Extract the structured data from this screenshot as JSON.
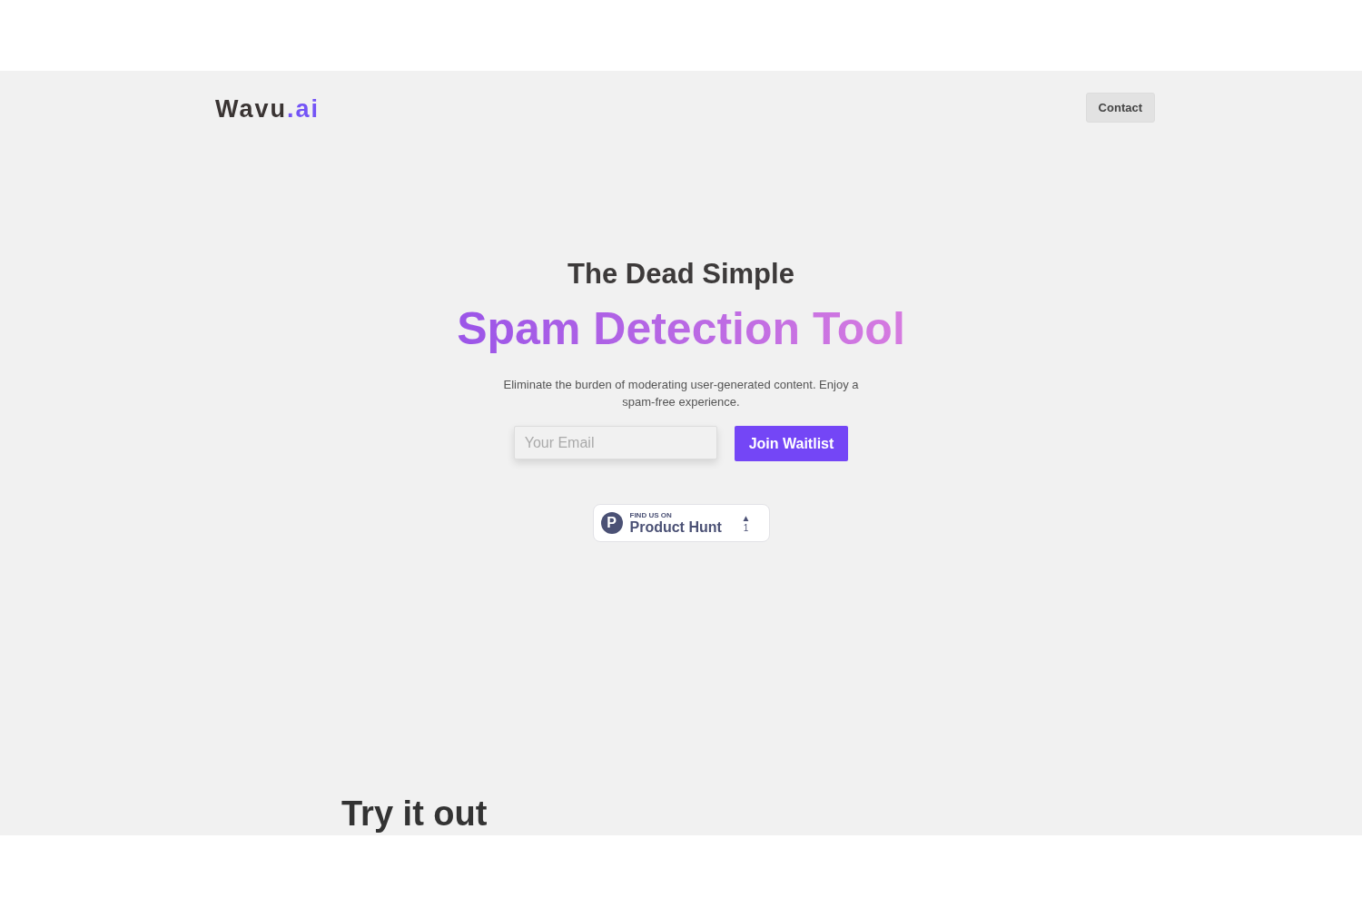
{
  "header": {
    "logo": {
      "name": "Wavu",
      "suffix": ".ai"
    },
    "contact_button": "Contact"
  },
  "hero": {
    "kicker": "The Dead Simple",
    "title": "Spam Detection Tool",
    "description": "Eliminate the burden of moderating user-generated content. Enjoy a spam-free experience.",
    "email": {
      "placeholder": "Your Email"
    },
    "join_button": "Join Waitlist"
  },
  "product_hunt": {
    "logo_letter": "P",
    "caption": "FIND US ON",
    "name": "Product Hunt",
    "arrow": "▲",
    "votes": "1"
  },
  "try_section": {
    "heading": "Try it out"
  }
}
